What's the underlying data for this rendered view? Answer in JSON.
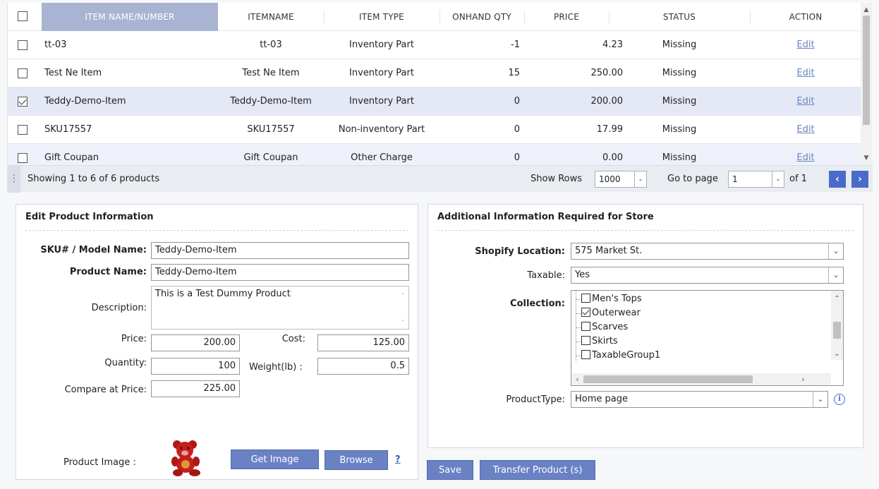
{
  "grid": {
    "columns": [
      "ITEM NAME/NUMBER",
      "ITEMNAME",
      "ITEM TYPE",
      "ONHAND QTY",
      "PRICE",
      "STATUS",
      "ACTION"
    ],
    "rows": [
      {
        "name_number": "tt-03",
        "item_name": "tt-03",
        "item_type": "Inventory Part",
        "onhand_qty": "-1",
        "price": "4.23",
        "status": "Missing",
        "action": "Edit",
        "checked": false
      },
      {
        "name_number": "Test Ne Item",
        "item_name": "Test Ne Item",
        "item_type": "Inventory Part",
        "onhand_qty": "15",
        "price": "250.00",
        "status": "Missing",
        "action": "Edit",
        "checked": false
      },
      {
        "name_number": "Teddy-Demo-Item",
        "item_name": "Teddy-Demo-Item",
        "item_type": "Inventory Part",
        "onhand_qty": "0",
        "price": "200.00",
        "status": "Missing",
        "action": "Edit",
        "checked": true
      },
      {
        "name_number": "SKU17557",
        "item_name": "SKU17557",
        "item_type": "Non-inventory Part",
        "onhand_qty": "0",
        "price": "17.99",
        "status": "Missing",
        "action": "Edit",
        "checked": false
      },
      {
        "name_number": "Gift Coupan",
        "item_name": "Gift Coupan",
        "item_type": "Other Charge",
        "onhand_qty": "0",
        "price": "0.00",
        "status": "Missing",
        "action": "Edit",
        "checked": false
      }
    ],
    "footer": {
      "showing": "Showing 1 to 6 of 6 products",
      "show_rows_label": "Show Rows",
      "show_rows_value": "1000",
      "goto_label": "Go to page",
      "goto_value": "1",
      "of_label": "of 1"
    }
  },
  "edit_panel": {
    "title": "Edit Product Information",
    "sku_label": "SKU# / Model Name:",
    "sku_value": "Teddy-Demo-Item",
    "product_name_label": "Product Name:",
    "product_name_value": "Teddy-Demo-Item",
    "description_label": "Description:",
    "description_value": "This is a Test Dummy Product",
    "price_label": "Price:",
    "price_value": "200.00",
    "cost_label": "Cost:",
    "cost_value": "125.00",
    "quantity_label": "Quantity:",
    "quantity_value": "100",
    "weight_label": "Weight(lb) :",
    "weight_value": "0.5",
    "compare_label": "Compare at Price:",
    "compare_value": "225.00",
    "image_label": "Product Image :",
    "get_image_button": "Get Image",
    "browse_button": "Browse",
    "help_link": "?"
  },
  "store_panel": {
    "title": "Additional Information Required for Store",
    "location_label": "Shopify Location:",
    "location_value": "575 Market St.",
    "taxable_label": "Taxable:",
    "taxable_value": "Yes",
    "collection_label": "Collection:",
    "collections": [
      {
        "label": "Men's Tops",
        "checked": false
      },
      {
        "label": "Outerwear",
        "checked": true
      },
      {
        "label": "Scarves",
        "checked": false
      },
      {
        "label": "Skirts",
        "checked": false
      },
      {
        "label": "TaxableGroup1",
        "checked": false
      }
    ],
    "product_type_label": "ProductType:",
    "product_type_value": "Home page"
  },
  "actions": {
    "save_button": "Save",
    "transfer_button": "Transfer Product (s)"
  },
  "colors": {
    "accent": "#4a6bc9",
    "button": "#6a82c4",
    "selected_row": "#e5e9f6",
    "sorted_header": "#a9b4d3",
    "link": "#6a86c3"
  }
}
